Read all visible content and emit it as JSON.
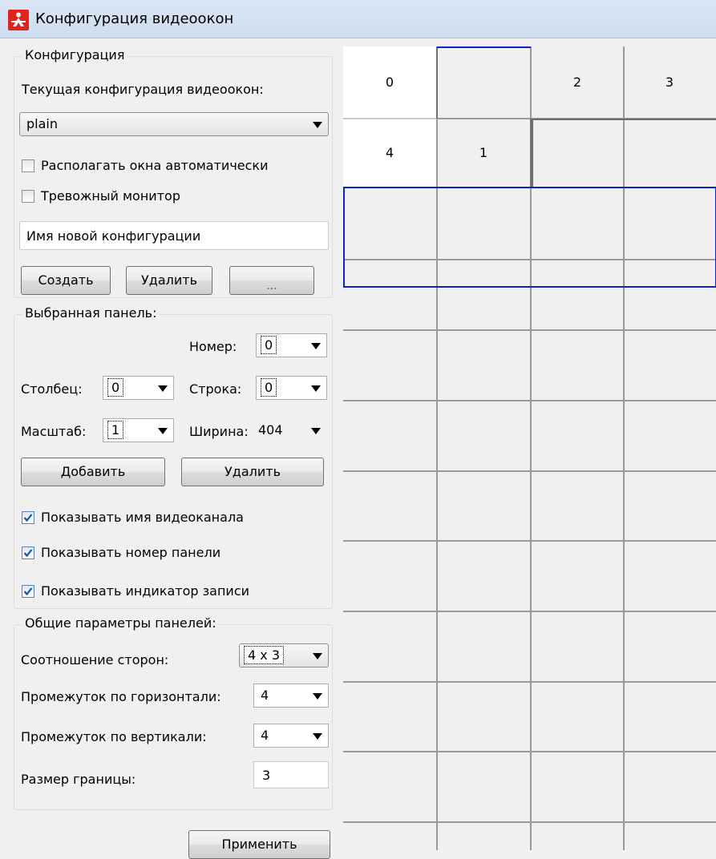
{
  "window": {
    "title": "Конфигурация видеоокон",
    "icon": "app-logo-icon"
  },
  "config_group": {
    "legend": "Конфигурация",
    "current_label": "Текущая конфигурация видеоокон:",
    "current_value": "plain",
    "auto_arrange": {
      "label": "Располагать окна автоматически",
      "checked": false
    },
    "alarm_monitor": {
      "label": "Тревожный монитор",
      "checked": false
    },
    "new_name_value": "Имя новой конфигурации",
    "create_label": "Создать",
    "delete_label": "Удалить",
    "more_label": "..."
  },
  "panel_group": {
    "legend": "Выбранная панель:",
    "number_label": "Номер:",
    "number_value": "0",
    "column_label": "Столбец:",
    "column_value": "0",
    "row_label": "Строка:",
    "row_value": "0",
    "scale_label": "Масштаб:",
    "scale_value": "1",
    "width_label": "Ширина:",
    "width_value": "404",
    "add_label": "Добавить",
    "delete_label": "Удалить",
    "show_channel_name": {
      "label": "Показывать имя видеоканала",
      "checked": true
    },
    "show_panel_number": {
      "label": "Показывать номер панели",
      "checked": true
    },
    "show_record_indicator": {
      "label": "Показывать индикатор записи",
      "checked": true
    }
  },
  "common_group": {
    "legend": "Общие параметры панелей:",
    "aspect_label": "Соотношение сторон:",
    "aspect_value": "4 x 3",
    "h_gap_label": "Промежуток по горизонтали:",
    "h_gap_value": "4",
    "v_gap_label": "Промежуток по вертикали:",
    "v_gap_value": "4",
    "border_label": "Размер границы:",
    "border_value": "3"
  },
  "apply_label": "Применить",
  "grid": {
    "panels": [
      {
        "label": "0",
        "state": "normal"
      },
      {
        "label": "",
        "state": "selected"
      },
      {
        "label": "2",
        "state": "normal"
      },
      {
        "label": "3",
        "state": "normal"
      },
      {
        "label": "4",
        "state": "normal"
      },
      {
        "label": "1",
        "state": "raised"
      }
    ],
    "colors": {
      "selection": "#0a24c8",
      "grid_line": "#9a9a9a",
      "panel_fill": "#f0f0f0",
      "panel_white": "#ffffff"
    }
  }
}
